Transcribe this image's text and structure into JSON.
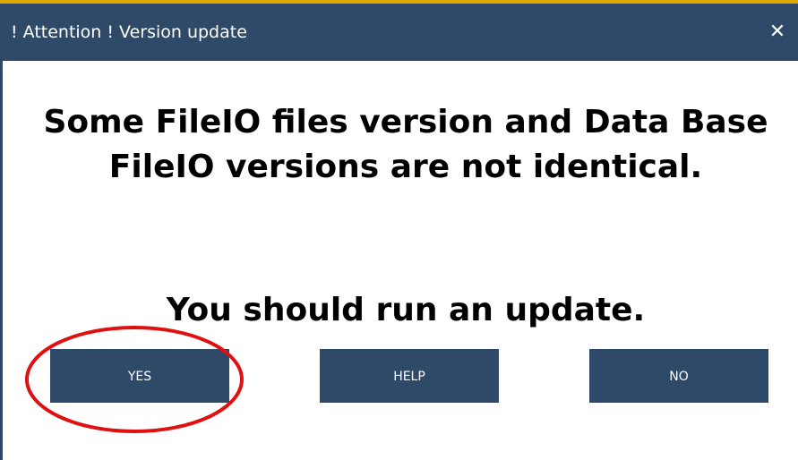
{
  "window": {
    "title": "! Attention ! Version update",
    "close_glyph": "✕"
  },
  "message": {
    "text": "Some FileIO files version and Data Base FileIO versions are not identical.",
    "action": "You should run an update."
  },
  "buttons": {
    "yes": "YES",
    "help": "HELP",
    "no": "NO"
  },
  "colors": {
    "titlebar": "#2e4a68",
    "accent": "#e0a800",
    "button": "#2e4a68",
    "highlight": "#e01010"
  }
}
